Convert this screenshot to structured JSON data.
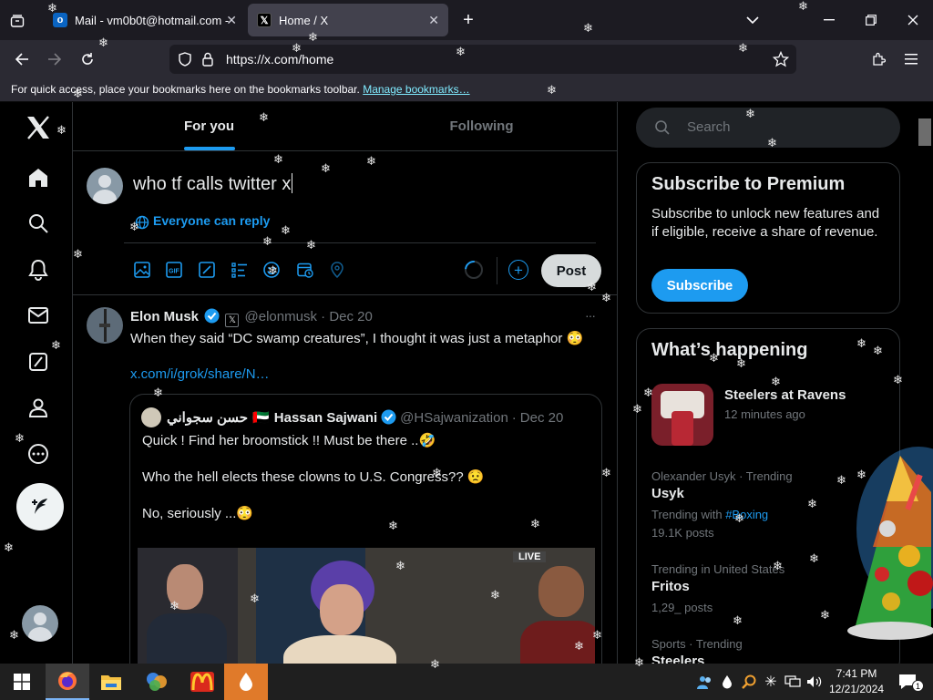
{
  "browser": {
    "tabs": [
      {
        "label": "Mail - vm0b0t@hotmail.com -",
        "favicon": "outlook"
      },
      {
        "label": "Home / X",
        "favicon": "x"
      }
    ],
    "url": "https://x.com/home",
    "bookmarks_text": "For quick access, place your bookmarks here on the bookmarks toolbar.",
    "bookmarks_link": "Manage bookmarks…"
  },
  "feed": {
    "tabs": [
      "For you",
      "Following"
    ],
    "composer": {
      "text": "who tf calls twitter x",
      "reply_setting": "Everyone can reply",
      "post_label": "Post"
    },
    "tweet": {
      "name": "Elon Musk",
      "handle": "@elonmusk",
      "sep": "·",
      "date": "Dec 20",
      "text": "When they said “DC swamp creatures”, I thought it was just a metaphor 😳",
      "link": "x.com/i/grok/share/N…",
      "more": "···",
      "quote": {
        "arabic_name": "حسن سجواني",
        "flag": "🇦🇪",
        "name": "Hassan Sajwani",
        "handle": "@HSajwanization",
        "sep": "·",
        "date": "Dec 20",
        "lines": [
          "Quick ! Find her broomstick !! Must be there ..🤣",
          "Who the hell elects these clowns to U.S. Congress?? 😟",
          "No, seriously ...😳"
        ],
        "video_badge": "LIVE"
      }
    }
  },
  "sidebar": {
    "search_placeholder": "Search",
    "premium": {
      "title": "Subscribe to Premium",
      "body": "Subscribe to unlock new features and if eligible, receive a share of revenue.",
      "button": "Subscribe"
    },
    "happening": {
      "title": "What’s happening",
      "event": {
        "name": "Steelers at Ravens",
        "time": "12 minutes ago"
      },
      "trends": [
        {
          "meta": "Olexander Usyk · Trending",
          "name": "Usyk",
          "with_label": "Trending with",
          "with_tag": "#Boxing",
          "count": "19.1K posts"
        },
        {
          "meta": "Trending in United States",
          "name": "Fritos",
          "count": "1,29_ posts"
        },
        {
          "meta": "Sports · Trending",
          "name": "Steelers"
        }
      ]
    }
  },
  "taskbar": {
    "time": "7:41 PM",
    "date": "12/21/2024",
    "notification_count": "1"
  },
  "colors": {
    "accent": "#1d9bf0",
    "background": "#000000",
    "border": "#2f3336",
    "muted": "#71767b"
  }
}
